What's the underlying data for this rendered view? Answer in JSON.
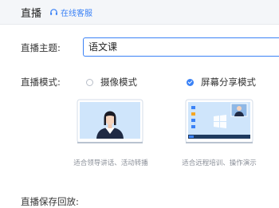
{
  "header": {
    "title": "直播",
    "service_icon": "headset-icon",
    "service_label": "在线客服"
  },
  "form": {
    "topic_label": "直播主题:",
    "topic_value": "语文课",
    "mode_label": "直播模式:",
    "save_label": "直播保存回放:"
  },
  "modes": [
    {
      "label": "摄像模式",
      "selected": false,
      "caption": "适合领导讲话、活动转播"
    },
    {
      "label": "屏幕分享模式",
      "selected": true,
      "caption": "适合远程培训、操作演示"
    }
  ],
  "colors": {
    "accent": "#3b82f6",
    "header_bg": "#f4f6f9"
  }
}
